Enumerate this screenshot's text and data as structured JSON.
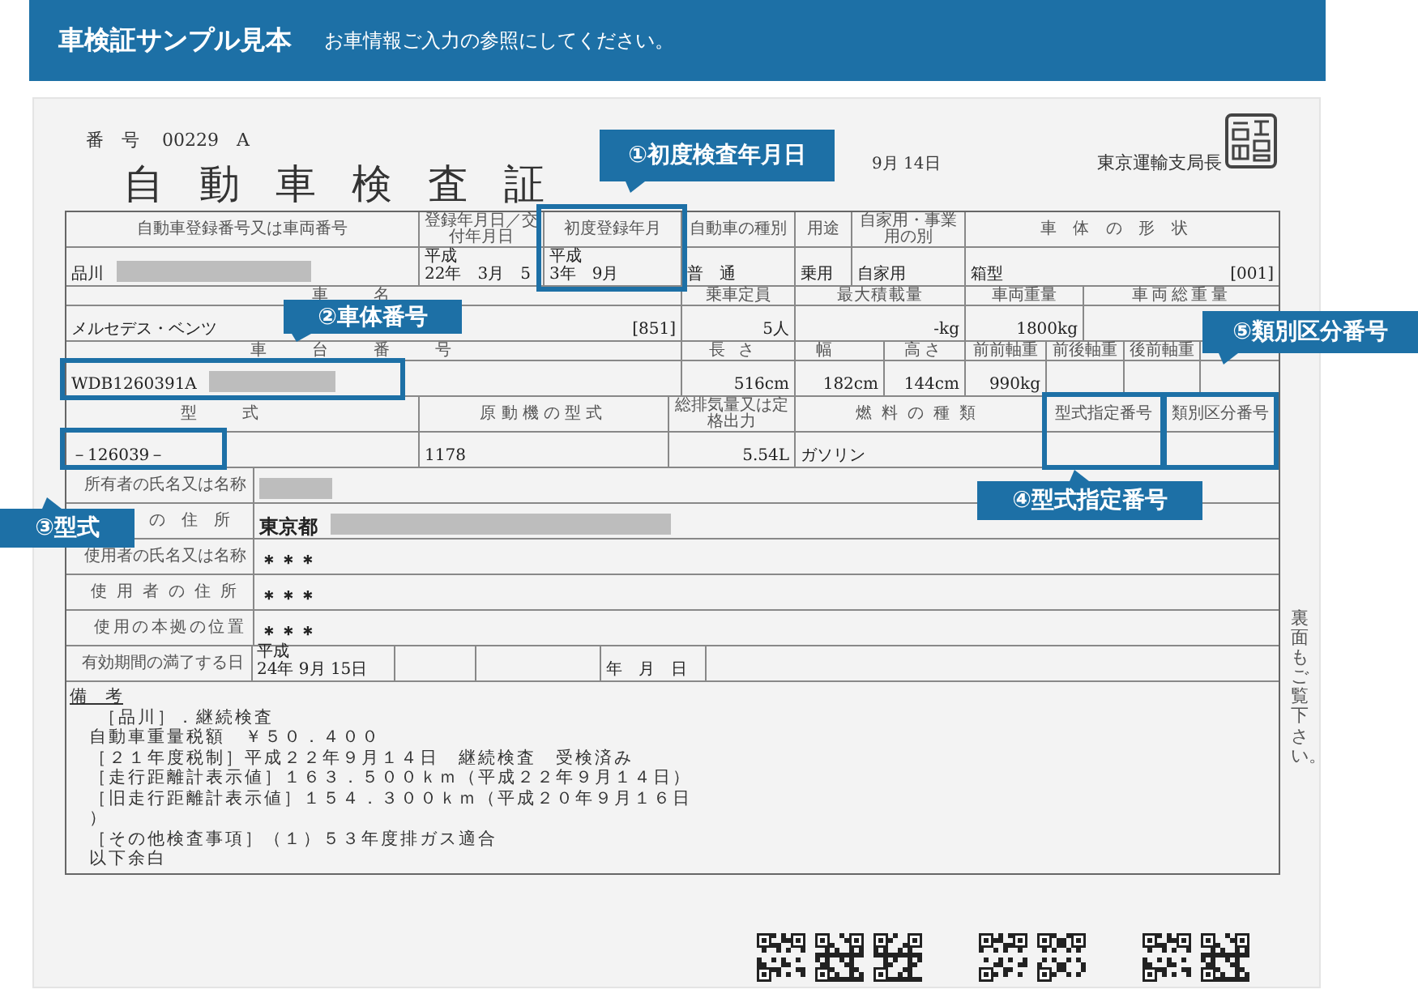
{
  "header": {
    "title": "車検証サンプル見本",
    "subtitle": "お車情報ご入力の参照にしてください。"
  },
  "certificate": {
    "number_label": "番　号",
    "number": "00229　A",
    "title": "自動車検査証",
    "date": "9月 14日",
    "issuer": "東京運輸支局長",
    "sections": [
      {
        "labels": [
          "自動車登録番号又は車両番号",
          "登録年月日／交付年月日",
          "初度登録年月",
          "自動車の種別",
          "用途",
          "自家用・事業用の別",
          "車体の形状"
        ],
        "values": [
          {
            "text": "品川",
            "redacted": true
          },
          {
            "text": "平成\n22年　3月　5"
          },
          {
            "text": "平成\n3年　9月"
          },
          {
            "text": "普　通"
          },
          {
            "text": "乗用"
          },
          {
            "text": "自家用"
          },
          {
            "text": "箱型",
            "code": "[001]"
          }
        ]
      },
      {
        "labels": [
          "車名",
          "乗車定員",
          "最大積載量",
          "車両重量",
          "車両総重量"
        ],
        "values": [
          {
            "text": "メルセデス・ベンツ",
            "code": "[851]"
          },
          {
            "text": "5人"
          },
          {
            "text": "-kg"
          },
          {
            "text": "1800kg"
          }
        ]
      },
      {
        "labels": [
          "車台番号",
          "長さ",
          "幅",
          "高さ",
          "前前軸重",
          "前後軸重",
          "後前軸重"
        ],
        "values": [
          {
            "text": "WDB1260391A",
            "redacted": true
          },
          {
            "text": "516cm"
          },
          {
            "text": "182cm"
          },
          {
            "text": "144cm"
          },
          {
            "text": "990kg"
          }
        ]
      },
      {
        "labels": [
          "型式",
          "原動機の型式",
          "総排気量又は定格出力",
          "燃料の種類",
          "型式指定番号",
          "類別区分番号"
        ],
        "values": [
          {
            "text": "－126039－"
          },
          {
            "text": "1178"
          },
          {
            "text": "5.54L"
          },
          {
            "text": "ガソリン"
          }
        ]
      }
    ],
    "persons": [
      {
        "label": "所有者の氏名又は名称",
        "value": {
          "redacted": true
        }
      },
      {
        "label": "の住所",
        "value": {
          "text": "東京都",
          "redacted": true
        }
      },
      {
        "label": "使用者の氏名又は名称",
        "value": {
          "text": "＊＊＊"
        }
      },
      {
        "label": "使用者の住所",
        "value": {
          "text": "＊＊＊"
        }
      },
      {
        "label": "使用の本拠の位置",
        "value": {
          "text": "＊＊＊"
        }
      }
    ],
    "expiry": {
      "label": "有効期間の満了する日",
      "date": "平成\n24年 9月 15日",
      "blank_date": "年　月　日"
    },
    "remarks": {
      "heading": "備　考",
      "lines": [
        "［品川］．継続検査",
        "自動車重量税額　￥５０．４００",
        "［２１年度税制］平成２２年９月１４日　継続検査　受検済み",
        "［走行距離計表示値］１６３．５００ｋｍ（平成２２年９月１４日）",
        "［旧走行距離計表示値］１５４．３００ｋｍ（平成２０年９月１６日",
        "）",
        "［その他検査事項］（１）５３年度排ガス適合",
        "以下余白"
      ]
    },
    "side_note": "裏面もご覧下さい。"
  },
  "annotations": [
    {
      "text": "①初度検査年月日"
    },
    {
      "text": "②車体番号"
    },
    {
      "text": "③型式"
    },
    {
      "text": "④型式指定番号"
    },
    {
      "text": "⑤類別区分番号"
    }
  ]
}
